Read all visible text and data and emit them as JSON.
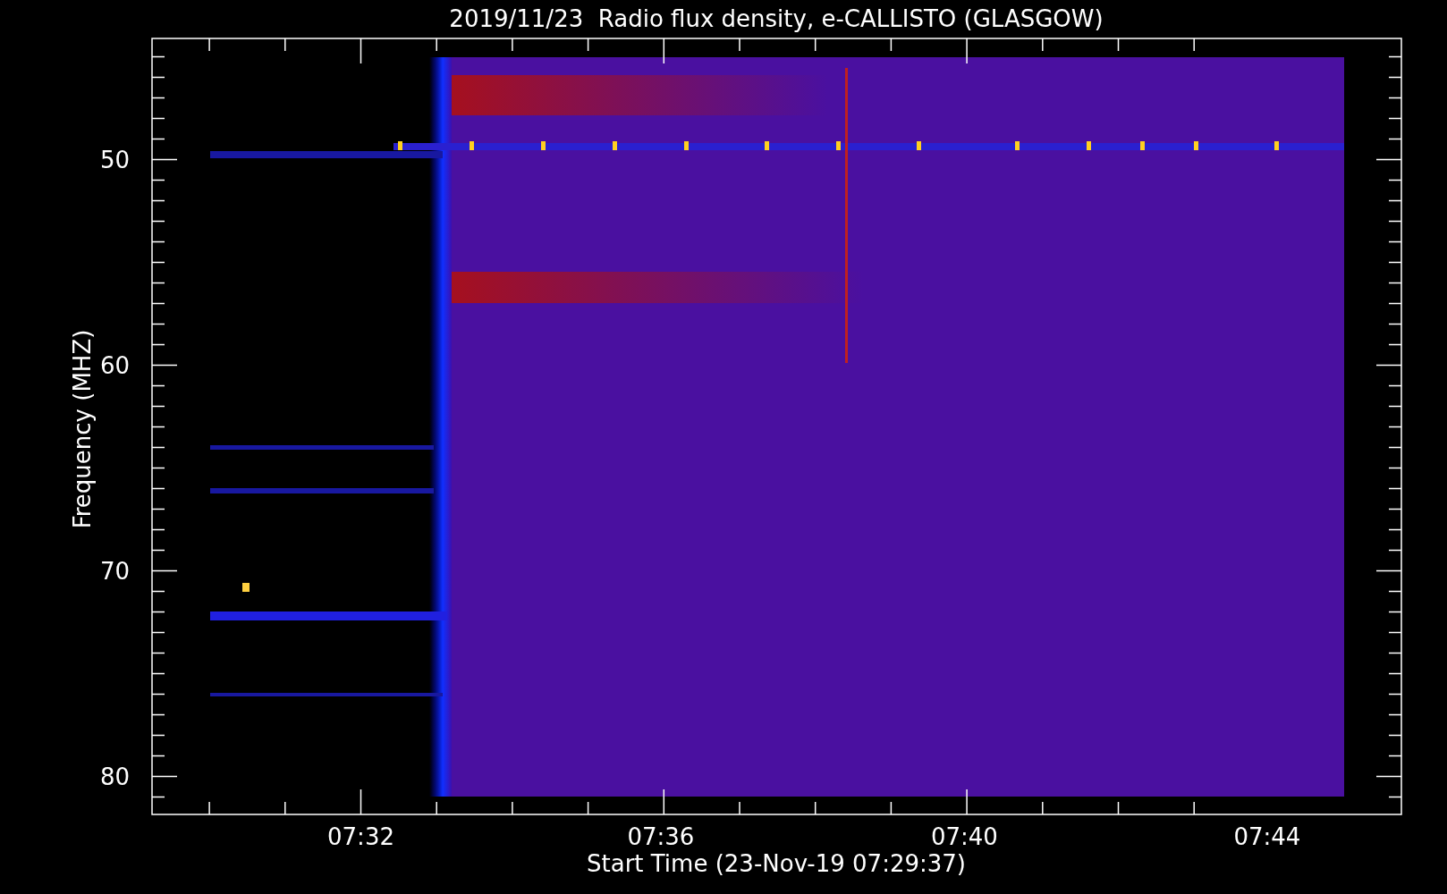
{
  "title": "2019/11/23  Radio flux density, e-CALLISTO (GLASGOW)",
  "y_axis": {
    "label": "Frequency (MHZ)",
    "ticks": [
      "50",
      "60",
      "70",
      "80"
    ]
  },
  "x_axis": {
    "label": "Start Time (23-Nov-19 07:29:37)",
    "ticks": [
      "07:32",
      "07:36",
      "07:40",
      "07:44"
    ]
  }
}
